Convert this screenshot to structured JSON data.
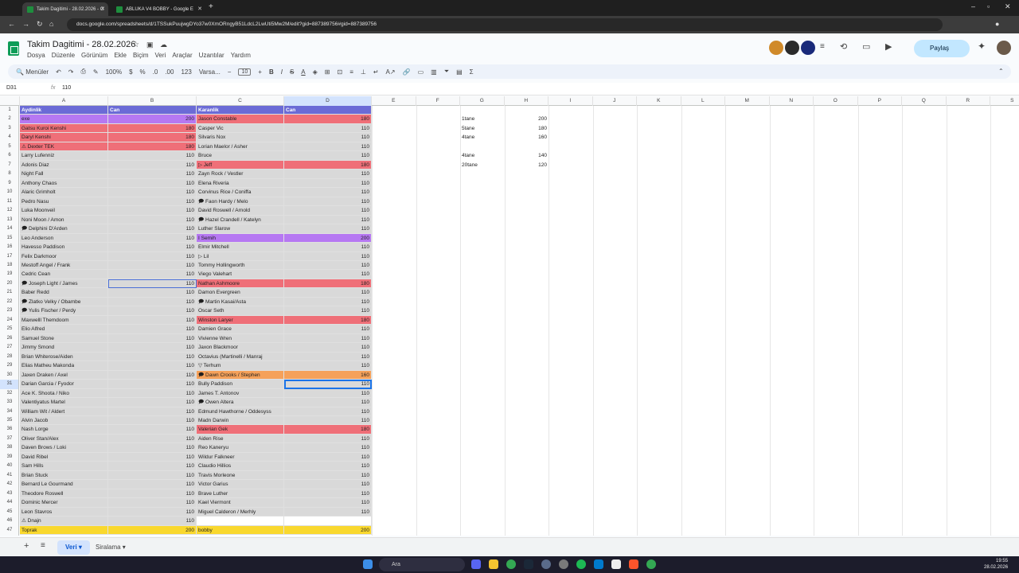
{
  "browser": {
    "tabs": [
      {
        "label": "Takim Dagitimi - 28.02.2026 - G",
        "active": true
      },
      {
        "label": "ABLUKA V4 BOBBY - Google E",
        "active": false
      }
    ],
    "url": "docs.google.com/spreadsheets/d/1TSSukPuujwgDYo37w0XmORngyB51LdcL2LwUti5Mw2M/edit?gid=887389756#gid=887389756"
  },
  "doc": {
    "title": "Takim Dagitimi - 28.02.2026",
    "menu": [
      "Dosya",
      "Düzenle",
      "Görünüm",
      "Ekle",
      "Biçim",
      "Veri",
      "Araçlar",
      "Uzantılar",
      "Yardım"
    ],
    "share_label": "Paylaş"
  },
  "toolbar": {
    "menus_label": "Menüler",
    "zoom": "100%",
    "currency": "$",
    "percent": "%",
    "dec_less": ".0",
    "dec_more": ".00",
    "num_format": "123",
    "font": "Varsa...",
    "font_size": "10"
  },
  "formula_bar": {
    "cell_ref": "D31",
    "fx": "fx",
    "value": "110"
  },
  "columns": [
    "A",
    "B",
    "C",
    "D",
    "E",
    "F",
    "G",
    "H",
    "I",
    "J",
    "K",
    "L",
    "M",
    "N",
    "O",
    "P",
    "Q",
    "R",
    "S"
  ],
  "header_row": {
    "a": "Aydinlik",
    "b": "Can",
    "c": "Karanlik",
    "d": "Can"
  },
  "rows": [
    {
      "a": "exe",
      "b": "200",
      "c": "Jason Constable",
      "d": "180"
    },
    {
      "a": "Gatsu Kuroi Kenshi",
      "b": "180",
      "c": "Casper Vic",
      "d": "110"
    },
    {
      "a": "Daryl Kenshi",
      "b": "180",
      "c": "Silvaris Nox",
      "d": "110"
    },
    {
      "a": "⚠ Dexter TEK",
      "b": "180",
      "c": "Lorian Maelor / Asher",
      "d": "110"
    },
    {
      "a": "Larry Lufenniz",
      "b": "110",
      "c": "Bruce",
      "d": "110"
    },
    {
      "a": "Adonis Diaz",
      "b": "110",
      "c": "▷ Jeff",
      "d": "180"
    },
    {
      "a": "Night Fall",
      "b": "110",
      "c": "Zayn Rock / Vestler",
      "d": "110"
    },
    {
      "a": "Anthony Chaos",
      "b": "110",
      "c": "Elena Riveria",
      "d": "110"
    },
    {
      "a": "Alaric Grimholt",
      "b": "110",
      "c": "Corvinus Rice / Coniffa",
      "d": "110"
    },
    {
      "a": "Pedro Nasu",
      "b": "110",
      "c": "🗩 Faon Hardy / Melo",
      "d": "110"
    },
    {
      "a": "Luka Moonveil",
      "b": "110",
      "c": "David Roswell / Arnold",
      "d": "110"
    },
    {
      "a": "Noni Moon / Amon",
      "b": "110",
      "c": "🗩 Hazel Crandell / Katelyn",
      "d": "110"
    },
    {
      "a": "🗩 Delphini D'Arden",
      "b": "110",
      "c": "Luther Slarow",
      "d": "110"
    },
    {
      "a": "Leo Anderson",
      "b": "110",
      "c": "I Semih",
      "d": "200"
    },
    {
      "a": "Havesso Paddison",
      "b": "110",
      "c": "Elmir Mitchell",
      "d": "110"
    },
    {
      "a": "Felix Darkmoor",
      "b": "110",
      "c": "▷ Lil",
      "d": "110"
    },
    {
      "a": "Mestoff Angel / Frank",
      "b": "110",
      "c": "Tommy Hollingworth",
      "d": "110"
    },
    {
      "a": "Cedric Cean",
      "b": "110",
      "c": "Viego Valehart",
      "d": "110"
    },
    {
      "a": "🗩 Joseph Light / James",
      "b": "110",
      "c": "Nathan Ashmoore",
      "d": "180"
    },
    {
      "a": "Baber Redd",
      "b": "110",
      "c": "Damon Evergreen",
      "d": "110"
    },
    {
      "a": "🗩 Zlatko Velky / Obambe",
      "b": "110",
      "c": "🗩 Martin Kasai/Asta",
      "d": "110"
    },
    {
      "a": "🗩 Yulis Fischer / Perdy",
      "b": "110",
      "c": "Oscar Seth",
      "d": "110"
    },
    {
      "a": "Maxwelll Themdoom",
      "b": "110",
      "c": "Winston Laryer",
      "d": "180"
    },
    {
      "a": "Elio Alfred",
      "b": "110",
      "c": "Damien Grace",
      "d": "110"
    },
    {
      "a": "Samuel Stone",
      "b": "110",
      "c": "Vivienne Wren",
      "d": "110"
    },
    {
      "a": "Jimmy Smond",
      "b": "110",
      "c": "Jaxon Blackmoor",
      "d": "110"
    },
    {
      "a": "Brian Whiterose/Aiden",
      "b": "110",
      "c": "Octavius (Martinelli / Manraj",
      "d": "110"
    },
    {
      "a": "Elias Matheu Makonda",
      "b": "110",
      "c": "▽ Terhum",
      "d": "110"
    },
    {
      "a": "Jaxen Draken / Axel",
      "b": "110",
      "c": "🗩 Dawn Crooks / Stephen",
      "d": "160"
    },
    {
      "a": "Darian Garcia / Fyodor",
      "b": "110",
      "c": "Bully Paddison",
      "d": "110"
    },
    {
      "a": "Ace K. Shoota / Niko",
      "b": "110",
      "c": "James T. Antonov",
      "d": "110"
    },
    {
      "a": "Valentiyatus Martel",
      "b": "110",
      "c": "🗩 Owen Altera",
      "d": "110"
    },
    {
      "a": "William Wit / Aldert",
      "b": "110",
      "c": "Edmund Hawthorne / Oddesyss",
      "d": "110"
    },
    {
      "a": "Alvin Jacob",
      "b": "110",
      "c": "Madn Darwin",
      "d": "110"
    },
    {
      "a": "Nash Lorge",
      "b": "110",
      "c": "Valerian Gek",
      "d": "180"
    },
    {
      "a": "Oliver Stan/Alex",
      "b": "110",
      "c": "Aiden Rise",
      "d": "110"
    },
    {
      "a": "Daven Brows / Loki",
      "b": "110",
      "c": "Reo Kaneryu",
      "d": "110"
    },
    {
      "a": "David Ribel",
      "b": "110",
      "c": "Wildur Falkneer",
      "d": "110"
    },
    {
      "a": "Sam Hills",
      "b": "110",
      "c": "Claudio Hillios",
      "d": "110"
    },
    {
      "a": "Brian Stuck",
      "b": "110",
      "c": "Travis Morleone",
      "d": "110"
    },
    {
      "a": "Bernard Le Gourmand",
      "b": "110",
      "c": "Victor Garius",
      "d": "110"
    },
    {
      "a": "Theodore Roswell",
      "b": "110",
      "c": "Brave Luther",
      "d": "110"
    },
    {
      "a": "Dominic Mercer",
      "b": "110",
      "c": "Kael Viermont",
      "d": "110"
    },
    {
      "a": "Leon Stavros",
      "b": "110",
      "c": "Miguel Calderon / Merhly",
      "d": "110"
    },
    {
      "a": "⚠ Dnajn",
      "b": "110",
      "c": "",
      "d": ""
    },
    {
      "a": "Toprak",
      "b": "200",
      "c": "bobby",
      "d": "200"
    }
  ],
  "summary": [
    {
      "label": "1tane",
      "value": "200"
    },
    {
      "label": "5tane",
      "value": "180"
    },
    {
      "label": "4tane",
      "value": "160"
    },
    {
      "label": "",
      "value": ""
    },
    {
      "label": "4tane",
      "value": "140"
    },
    {
      "label": "20tane",
      "value": "120"
    }
  ],
  "sheets": [
    {
      "label": "Veri",
      "active": true
    },
    {
      "label": "Siralama",
      "active": false
    }
  ],
  "taskbar": {
    "search": "Ara",
    "time": "19:55",
    "date": "28.02.2026"
  },
  "colors": {
    "purple": "#b678f2",
    "red": "#ef6f78",
    "orange": "#f5a15a",
    "yellow": "#f9d82e",
    "header": "#6b6bd6",
    "body_gray": "#d9d9d9"
  }
}
